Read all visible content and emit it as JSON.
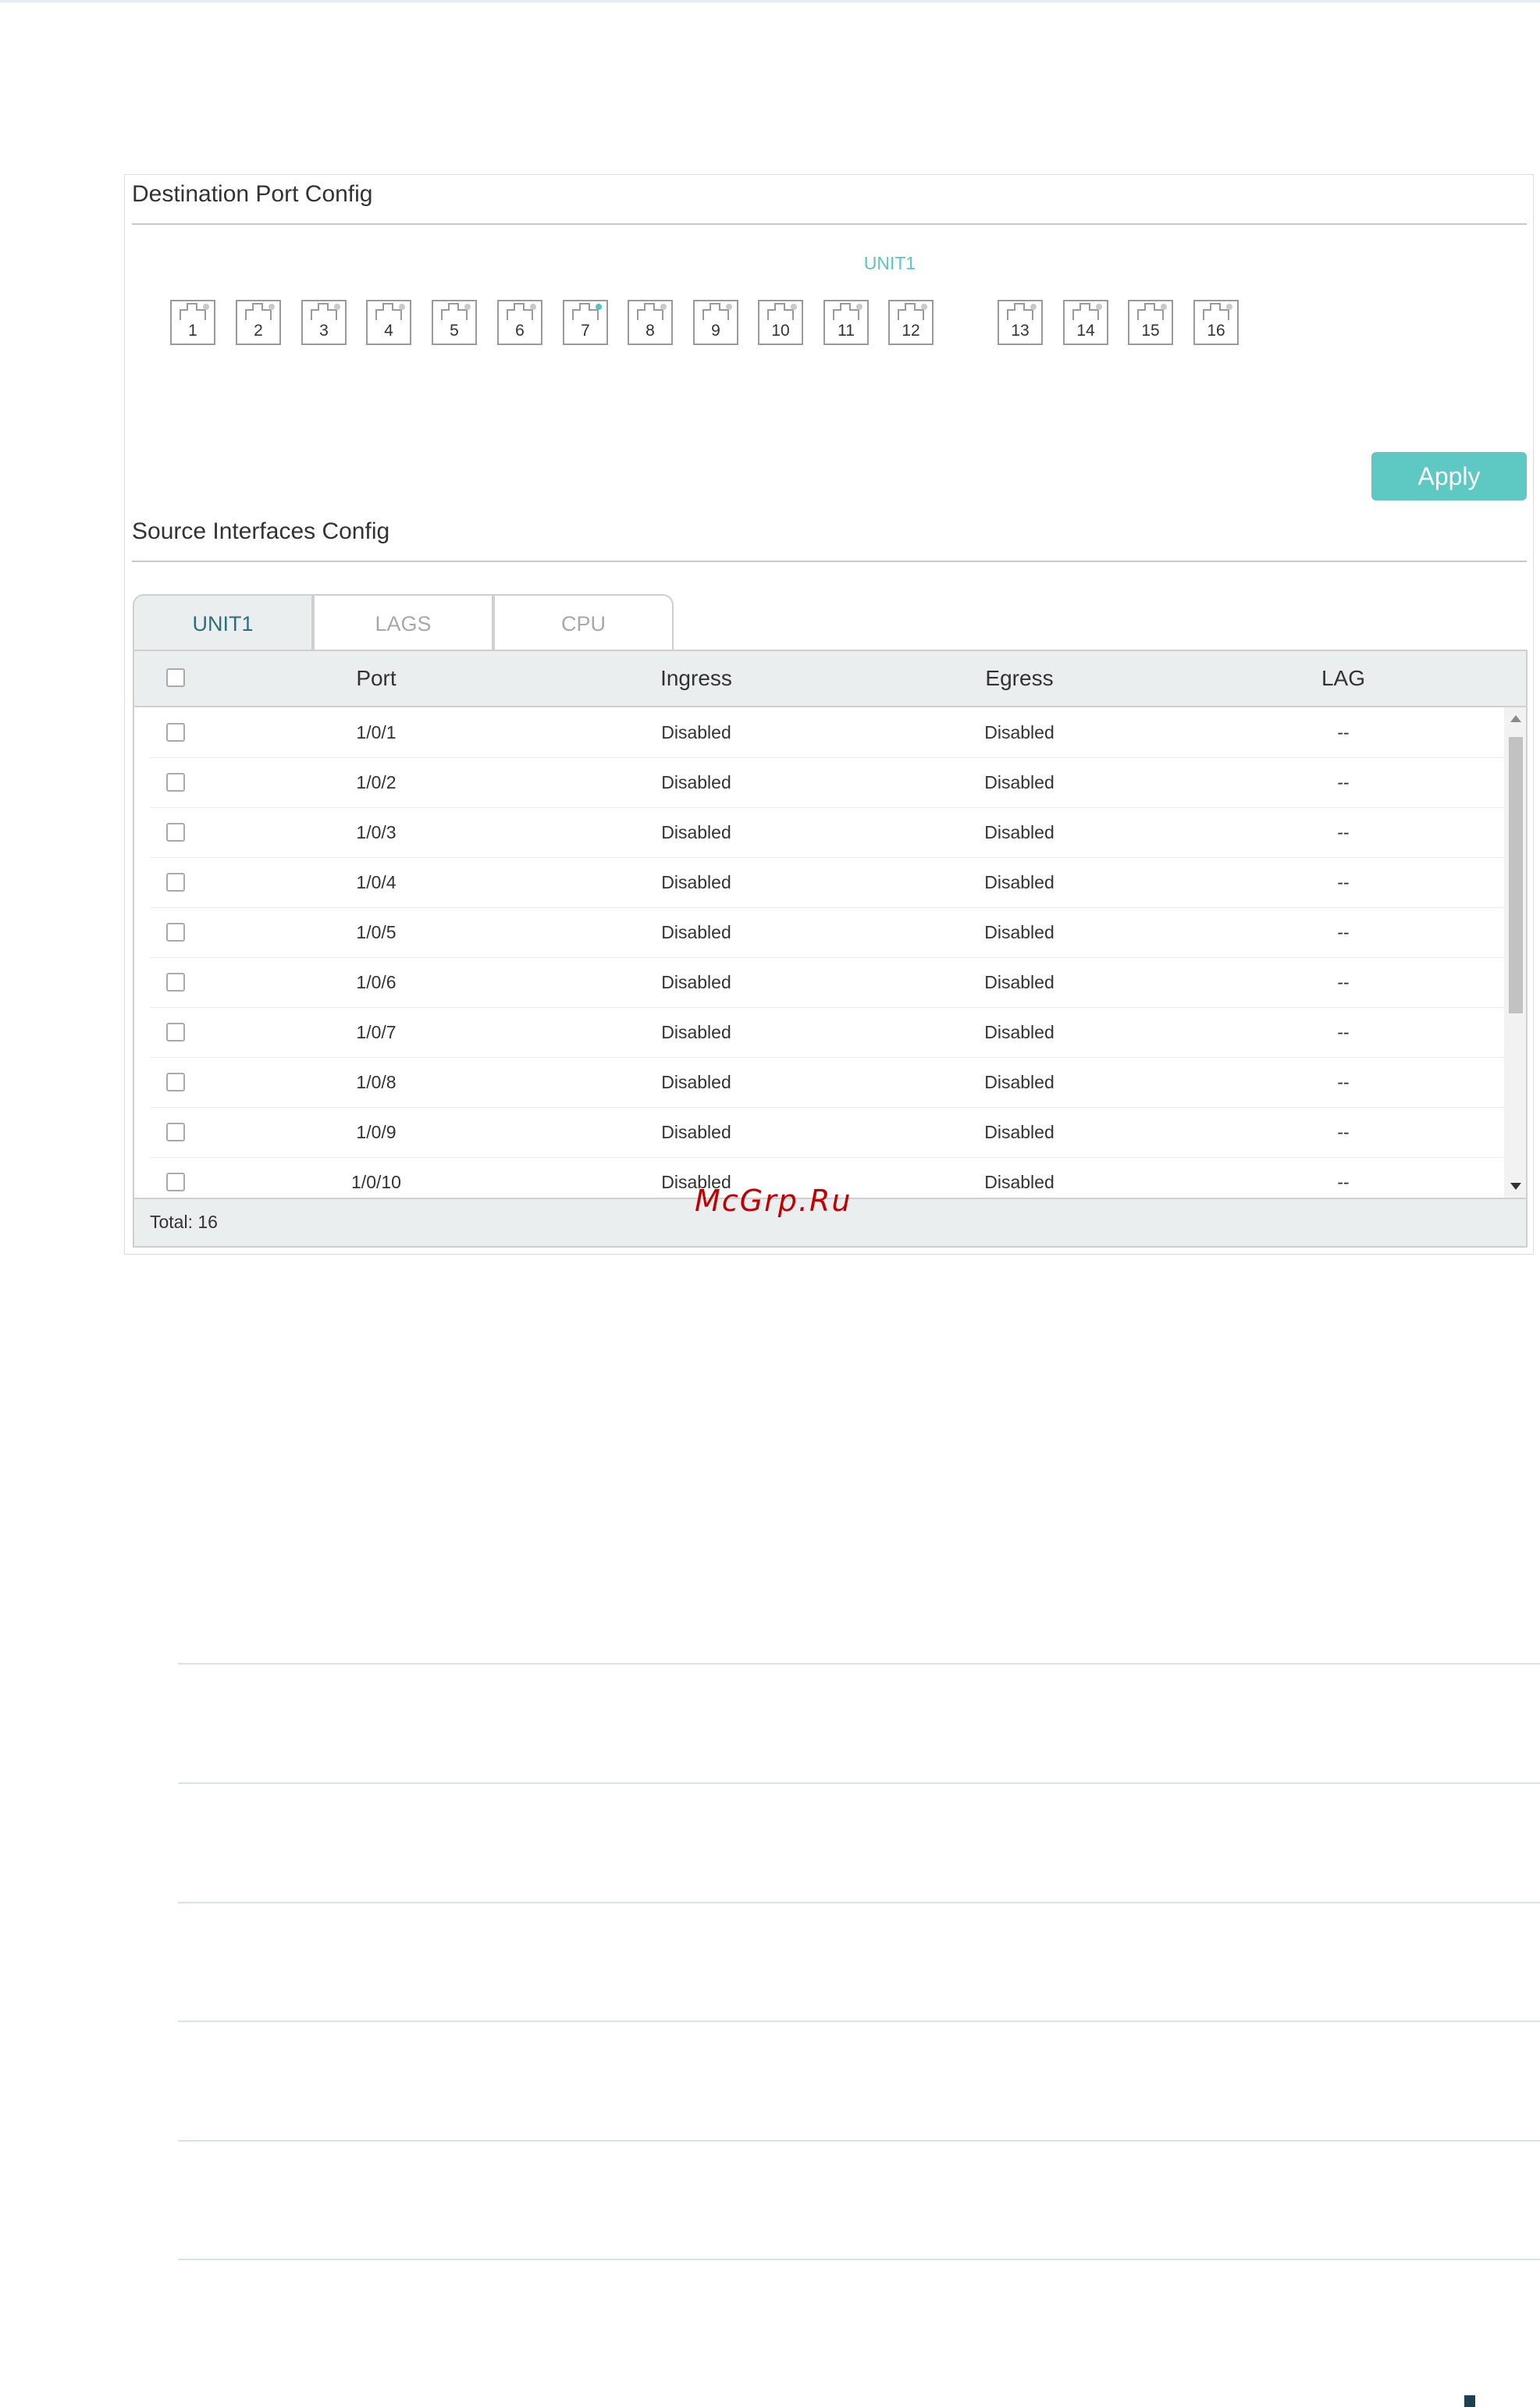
{
  "destination": {
    "title": "Destination Port Config",
    "unit_label": "UNIT1",
    "ports": [
      "1",
      "2",
      "3",
      "4",
      "5",
      "6",
      "7",
      "8",
      "9",
      "10",
      "11",
      "12",
      "13",
      "14",
      "15",
      "16"
    ],
    "active_port": "7",
    "apply_label": "Apply"
  },
  "source": {
    "title": "Source Interfaces Config",
    "tabs": [
      "UNIT1",
      "LAGS",
      "CPU"
    ],
    "active_tab": "UNIT1",
    "columns": [
      "Port",
      "Ingress",
      "Egress",
      "LAG"
    ],
    "rows": [
      {
        "port": "1/0/1",
        "ingress": "Disabled",
        "egress": "Disabled",
        "lag": "--"
      },
      {
        "port": "1/0/2",
        "ingress": "Disabled",
        "egress": "Disabled",
        "lag": "--"
      },
      {
        "port": "1/0/3",
        "ingress": "Disabled",
        "egress": "Disabled",
        "lag": "--"
      },
      {
        "port": "1/0/4",
        "ingress": "Disabled",
        "egress": "Disabled",
        "lag": "--"
      },
      {
        "port": "1/0/5",
        "ingress": "Disabled",
        "egress": "Disabled",
        "lag": "--"
      },
      {
        "port": "1/0/6",
        "ingress": "Disabled",
        "egress": "Disabled",
        "lag": "--"
      },
      {
        "port": "1/0/7",
        "ingress": "Disabled",
        "egress": "Disabled",
        "lag": "--"
      },
      {
        "port": "1/0/8",
        "ingress": "Disabled",
        "egress": "Disabled",
        "lag": "--"
      },
      {
        "port": "1/0/9",
        "ingress": "Disabled",
        "egress": "Disabled",
        "lag": "--"
      },
      {
        "port": "1/0/10",
        "ingress": "Disabled",
        "egress": "Disabled",
        "lag": "--"
      }
    ],
    "total_label": "Total: 16"
  },
  "watermark": "McGrp.Ru",
  "colors": {
    "accent": "#5ec8c3",
    "active_tab_text": "#2d6e7e",
    "header_bg": "#eaeeee"
  }
}
